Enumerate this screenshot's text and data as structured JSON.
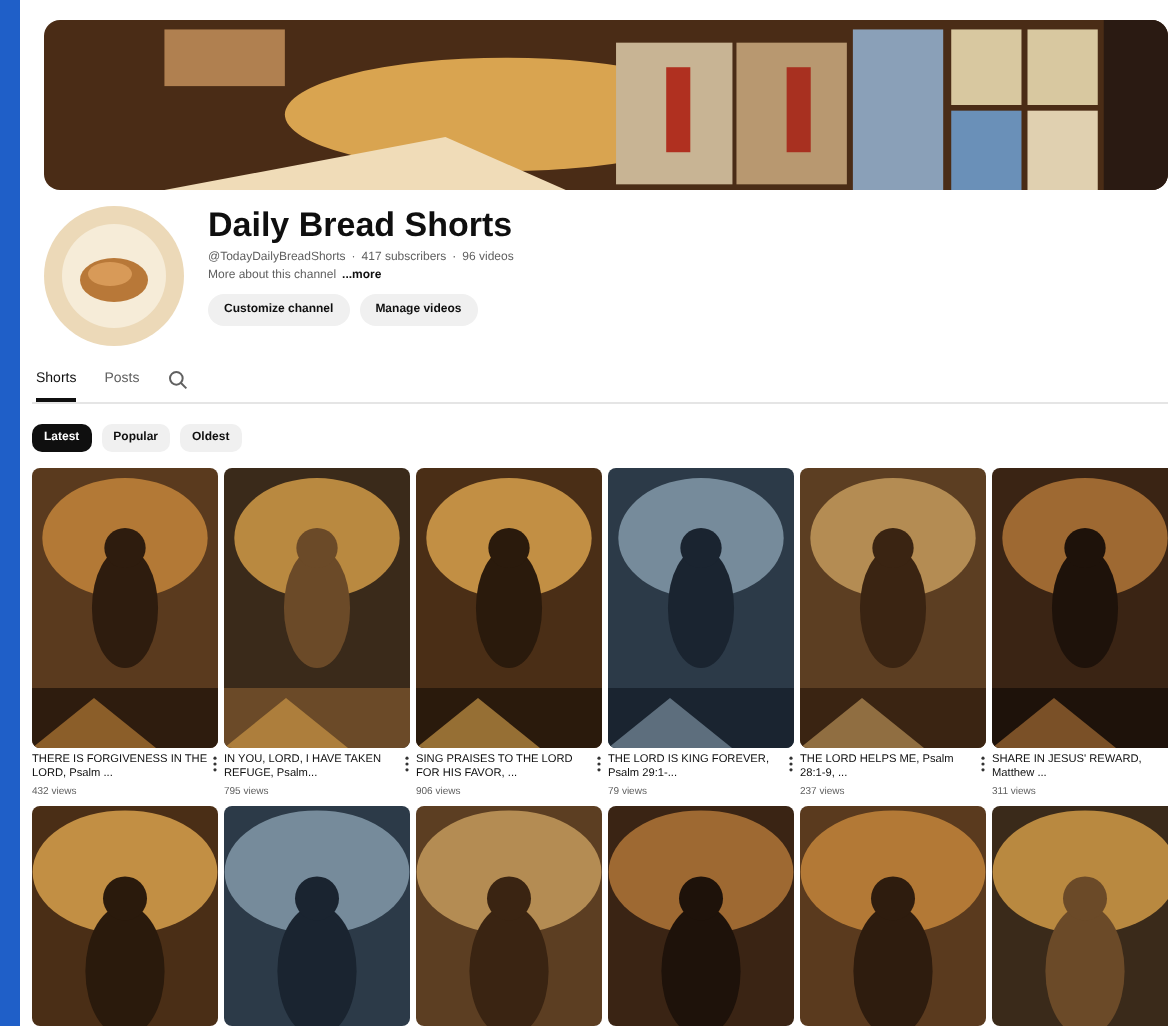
{
  "channel": {
    "name": "Daily Bread Shorts",
    "handle": "@TodayDailyBreadShorts",
    "subscribers": "417 subscribers",
    "videos": "96 videos",
    "separator": "·",
    "about": "More about this channel",
    "more": "...more"
  },
  "actions": [
    "Customize channel",
    "Manage videos"
  ],
  "tabs": [
    {
      "label": "Shorts",
      "selected": true
    },
    {
      "label": "Posts",
      "selected": false
    }
  ],
  "chips": [
    {
      "label": "Latest",
      "selected": true
    },
    {
      "label": "Popular",
      "selected": false
    },
    {
      "label": "Oldest",
      "selected": false
    }
  ],
  "shorts": [
    {
      "title": "THERE IS FORGIVENESS IN THE LORD, Psalm ...",
      "views": "432 views"
    },
    {
      "title": "IN YOU, LORD, I HAVE TAKEN REFUGE, Psalm...",
      "views": "795 views"
    },
    {
      "title": "SING PRAISES TO THE LORD FOR HIS FAVOR, ...",
      "views": "906 views"
    },
    {
      "title": "THE LORD IS KING FOREVER, Psalm 29:1-...",
      "views": "79 views"
    },
    {
      "title": "THE LORD HELPS ME, Psalm 28:1-9, ...",
      "views": "237 views"
    },
    {
      "title": "SHARE IN JESUS' REWARD, Matthew ...",
      "views": "311 views"
    }
  ],
  "shorts_row_2": [
    {
      "kind": "picture"
    },
    {
      "kind": "picture"
    },
    {
      "kind": "picture"
    },
    {
      "kind": "picture"
    },
    {
      "kind": "picture"
    },
    {
      "kind": "picture"
    }
  ]
}
